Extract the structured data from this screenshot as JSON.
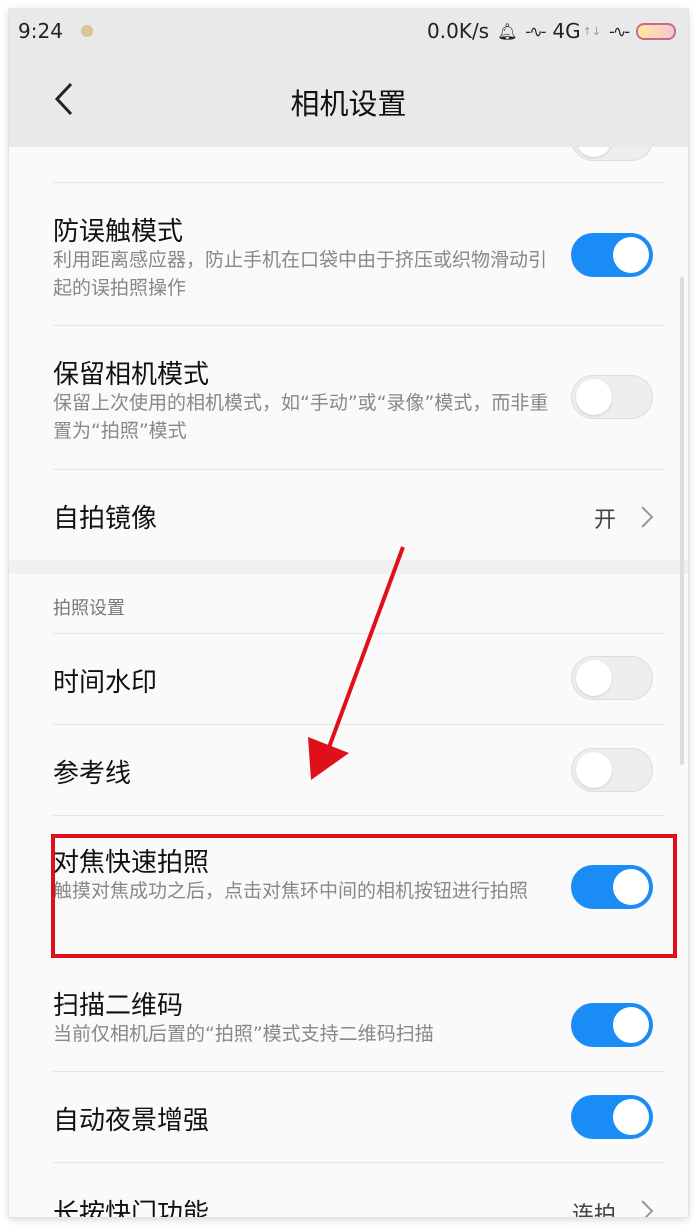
{
  "status_bar": {
    "time": "9:24",
    "speed": "0.0K/s",
    "network": "4G"
  },
  "header": {
    "title": "相机设置"
  },
  "settings": {
    "prev_toggle_on": false,
    "anti_mistouch": {
      "title": "防误触模式",
      "desc": "利用距离感应器，防止手机在口袋中由于挤压或织物滑动引起的误拍照操作",
      "on": true
    },
    "keep_mode": {
      "title": "保留相机模式",
      "desc": "保留上次使用的相机模式，如“手动”或“录像”模式，而非重置为“拍照”模式",
      "on": false
    },
    "selfie_mirror": {
      "title": "自拍镜像",
      "value": "开"
    },
    "photo_section": {
      "header": "拍照设置"
    },
    "time_watermark": {
      "title": "时间水印",
      "on": false
    },
    "grid_lines": {
      "title": "参考线",
      "on": false
    },
    "focus_shoot": {
      "title": "对焦快速拍照",
      "desc": "触摸对焦成功之后，点击对焦环中间的相机按钮进行拍照",
      "on": true
    },
    "qr_scan": {
      "title": "扫描二维码",
      "desc": "当前仅相机后置的“拍照”模式支持二维码扫描",
      "on": true
    },
    "night_enhance": {
      "title": "自动夜景增强",
      "on": true
    },
    "long_press_shutter": {
      "title": "长按快门功能",
      "value": "连拍"
    }
  },
  "colors": {
    "toggle_on": "#1a8cf5",
    "annotation_red": "#e0101a"
  }
}
